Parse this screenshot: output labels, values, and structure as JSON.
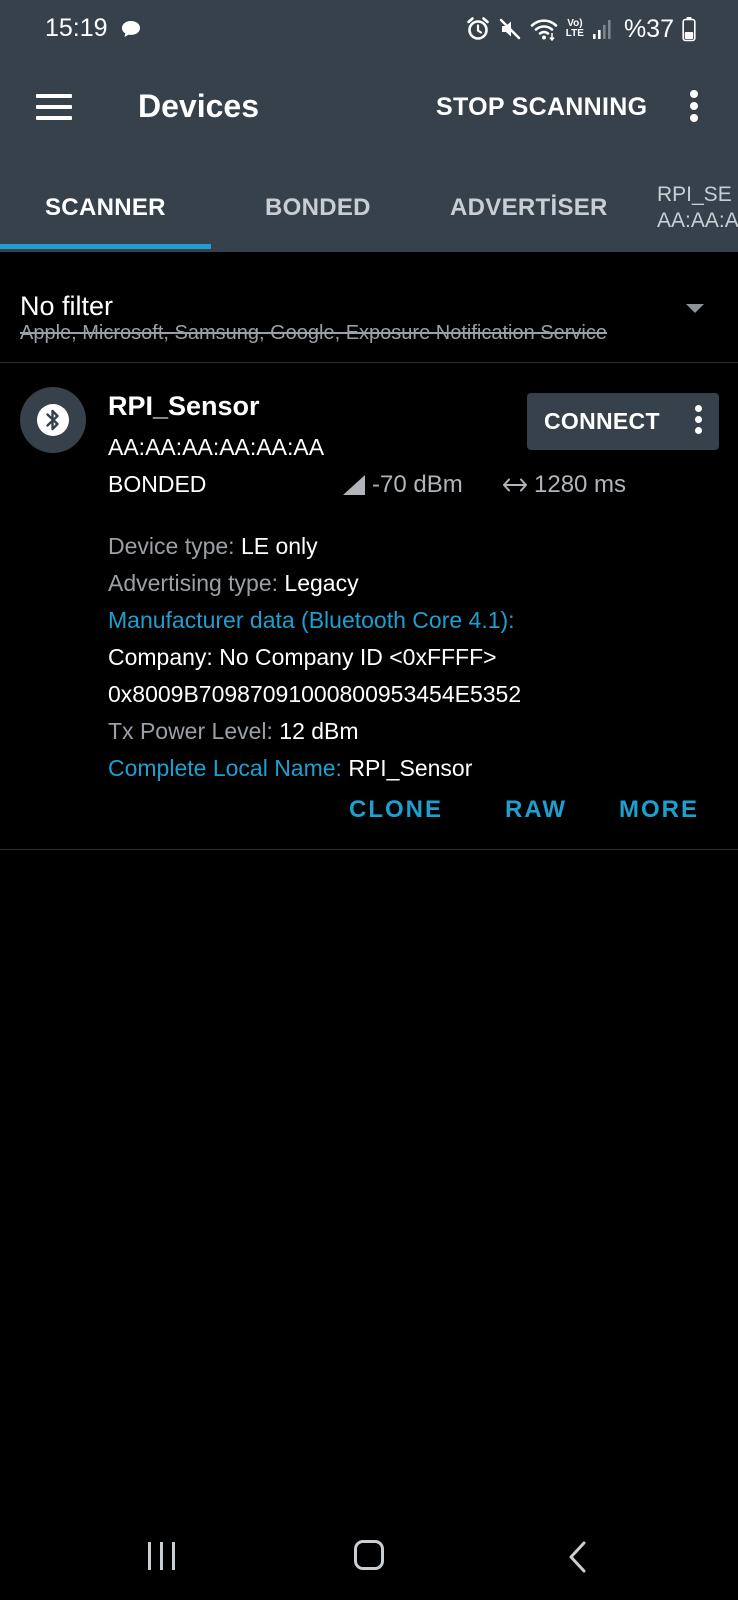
{
  "status_bar": {
    "time": "15:19",
    "lte_top": "Vo)",
    "lte_bottom": "LTE",
    "battery": "%37",
    "icons": [
      "chat-bubble-icon",
      "alarm-icon",
      "mute-icon",
      "wifi-icon",
      "volte-icon",
      "signal-icon",
      "battery-icon"
    ]
  },
  "toolbar": {
    "title": "Devices",
    "stop_scanning": "STOP SCANNING"
  },
  "tabs": {
    "items": [
      "SCANNER",
      "BONDED",
      "ADVERTİSER"
    ],
    "partial_name": "RPI_SE",
    "partial_addr": "AA:AA:A",
    "active": "SCANNER",
    "accent": "#1e9fd0"
  },
  "filter": {
    "title": "No filter",
    "subtitle": "Apple, Microsoft, Samsung, Google, Exposure Notification Service"
  },
  "device": {
    "name": "RPI_Sensor",
    "address": "AA:AA:AA:AA:AA:AA",
    "bond_state": "BONDED",
    "rssi": "-70 dBm",
    "interval": "1280 ms",
    "connect_label": "CONNECT",
    "device_type_label": "Device type:",
    "device_type_value": "LE only",
    "adv_type_label": "Advertising type:",
    "adv_type_value": "Legacy",
    "manufacturer_label": "Manufacturer data (Bluetooth Core 4.1):",
    "company": "Company: No Company ID <0xFFFF>",
    "manufacturer_hex": "0x8009B70987091000800953454E5352",
    "tx_label": "Tx Power Level:",
    "tx_value": "12 dBm",
    "local_name_label": "Complete Local Name:",
    "local_name_value": "RPI_Sensor",
    "actions": {
      "clone": "CLONE",
      "raw": "RAW",
      "more": "MORE"
    }
  },
  "colors": {
    "header": "#37414b",
    "background": "#000000",
    "accent": "#1e9fd0"
  }
}
